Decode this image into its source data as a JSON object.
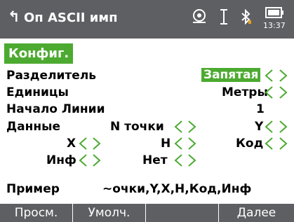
{
  "titlebar": {
    "back_icon": "back-arrow-icon",
    "title": "Оп ASCII имп",
    "icons": [
      "sync-icon",
      "cursor-icon",
      "bluetooth-icon",
      "battery-icon"
    ],
    "time": "13:37"
  },
  "tab": {
    "label": "Конфиг."
  },
  "rows": {
    "delimiter": {
      "label": "Разделитель",
      "value": "Запятая"
    },
    "units": {
      "label": "Единицы",
      "value": "Метры"
    },
    "line_start": {
      "label": "Начало Линии",
      "value": "1"
    }
  },
  "data_section": {
    "label": "Данные",
    "fields": {
      "n_point": "N точки",
      "y": "Y",
      "x": "X",
      "h": "H",
      "code": "Код",
      "info": "Инф",
      "none": "Нет"
    }
  },
  "example": {
    "label": "Пример",
    "value": "~очки,Y,X,H,Код,Инф"
  },
  "softkeys": [
    "Просм.",
    "Умолч.",
    "",
    "Далее"
  ],
  "colors": {
    "accent": "#4caa30",
    "bar": "#5e5f63"
  }
}
